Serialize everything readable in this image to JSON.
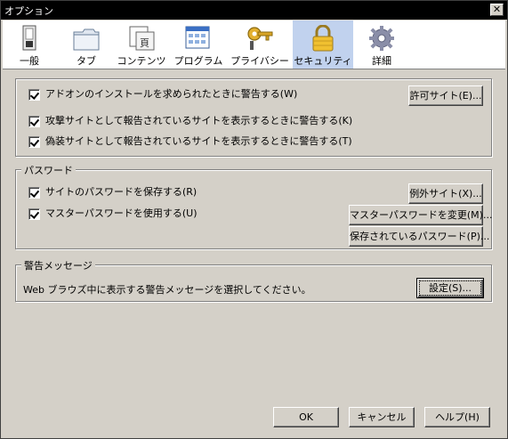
{
  "window": {
    "title": "オプション",
    "close_glyph": "✕"
  },
  "toolbar": {
    "items": [
      {
        "label": "一般",
        "icon": "general-icon",
        "selected": false
      },
      {
        "label": "タブ",
        "icon": "tabs-icon",
        "selected": false
      },
      {
        "label": "コンテンツ",
        "icon": "content-icon",
        "selected": false
      },
      {
        "label": "プログラム",
        "icon": "applications-icon",
        "selected": false
      },
      {
        "label": "プライバシー",
        "icon": "privacy-key-icon",
        "selected": false
      },
      {
        "label": "セキュリティ",
        "icon": "security-lock-icon",
        "selected": true
      },
      {
        "label": "詳細",
        "icon": "advanced-gear-icon",
        "selected": false
      }
    ]
  },
  "general_group": {
    "addons_warn": "アドオンのインストールを求められたときに警告する(W)",
    "attack_warn": "攻撃サイトとして報告されているサイトを表示するときに警告する(K)",
    "forgery_warn": "偽装サイトとして報告されているサイトを表示するときに警告する(T)",
    "exceptions_button": "許可サイト(E)..."
  },
  "password_group": {
    "title": "パスワード",
    "remember": "サイトのパスワードを保存する(R)",
    "use_master": "マスターパスワードを使用する(U)",
    "exceptions_button": "例外サイト(X)...",
    "change_master_button": "マスターパスワードを変更(M)...",
    "saved_button": "保存されているパスワード(P)..."
  },
  "warning_group": {
    "title": "警告メッセージ",
    "description": "Web ブラウズ中に表示する警告メッセージを選択してください。",
    "settings_button": "設定(S)..."
  },
  "footer": {
    "ok": "OK",
    "cancel": "キャンセル",
    "help": "ヘルプ(H)"
  },
  "colors": {
    "selected_tab": "#c1d2ee",
    "dialog_bg": "#d4d0c8",
    "titlebar": "#000000"
  }
}
